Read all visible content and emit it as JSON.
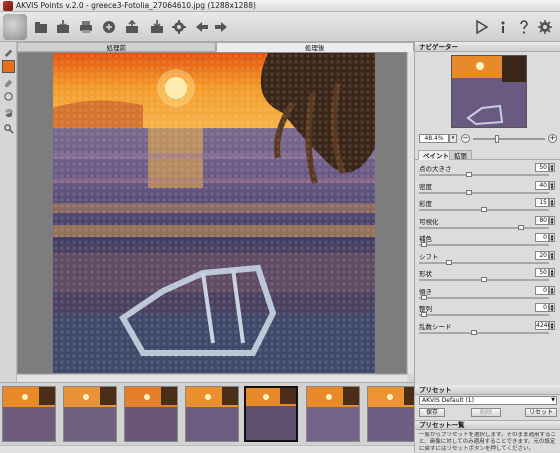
{
  "window": {
    "title": "AKVIS Points v.2.0 - greece3-Fotolia_27064610.jpg (1288x1288)"
  },
  "toolbar": {
    "icons": [
      "open-icon",
      "save-icon",
      "print-icon",
      "share-icon",
      "batch-icon",
      "upload-icon",
      "settings-gear-icon",
      "undo-arrow-icon",
      "redo-arrow-icon",
      "run-play-icon",
      "info-icon",
      "help-icon",
      "preferences-gear-icon"
    ]
  },
  "tools": [
    "brush-tool-icon",
    "color-swatch",
    "eraser-icon",
    "history-brush-icon",
    "hand-icon",
    "zoom-icon"
  ],
  "accent_color": "#e8701a",
  "canvas": {
    "tab_before": "処理前",
    "tab_after": "処理後",
    "active_tab": "after"
  },
  "navigator": {
    "title": "ナビゲーター",
    "zoom": "48.4%"
  },
  "params": {
    "tab_paint": "ペイント",
    "tab_canvas": "拡張",
    "items": [
      {
        "label": "点の大きさ",
        "value": "50",
        "level": 0.38
      },
      {
        "label": "密度",
        "value": "40",
        "level": 0.38
      },
      {
        "label": "彩度",
        "value": "15",
        "level": 0.5
      },
      {
        "label": "可視化",
        "value": "80",
        "level": 0.8
      },
      {
        "label": "補色",
        "value": "0",
        "level": 0.02
      },
      {
        "label": "シフト",
        "value": "20",
        "level": 0.22
      },
      {
        "label": "形状",
        "value": "50",
        "level": 0.5
      },
      {
        "label": "傾き",
        "value": "0",
        "level": 0.02
      },
      {
        "label": "整列",
        "value": "0",
        "level": 0.02
      },
      {
        "label": "乱数シード",
        "value": "4244",
        "level": 0.42
      }
    ]
  },
  "presets": {
    "title": "プリセット",
    "selected": "AKVIS Default (1)",
    "save": "保存",
    "delete": "削除",
    "reset": "リセット",
    "list_title": "プリセット一覧",
    "description": "一覧からプリセットを選択します。そのまま適用すること、画像に対してのみ適用することできます。元の設定に戻すにはリセットボタンを押してください。"
  },
  "thumbnails_count": 7
}
